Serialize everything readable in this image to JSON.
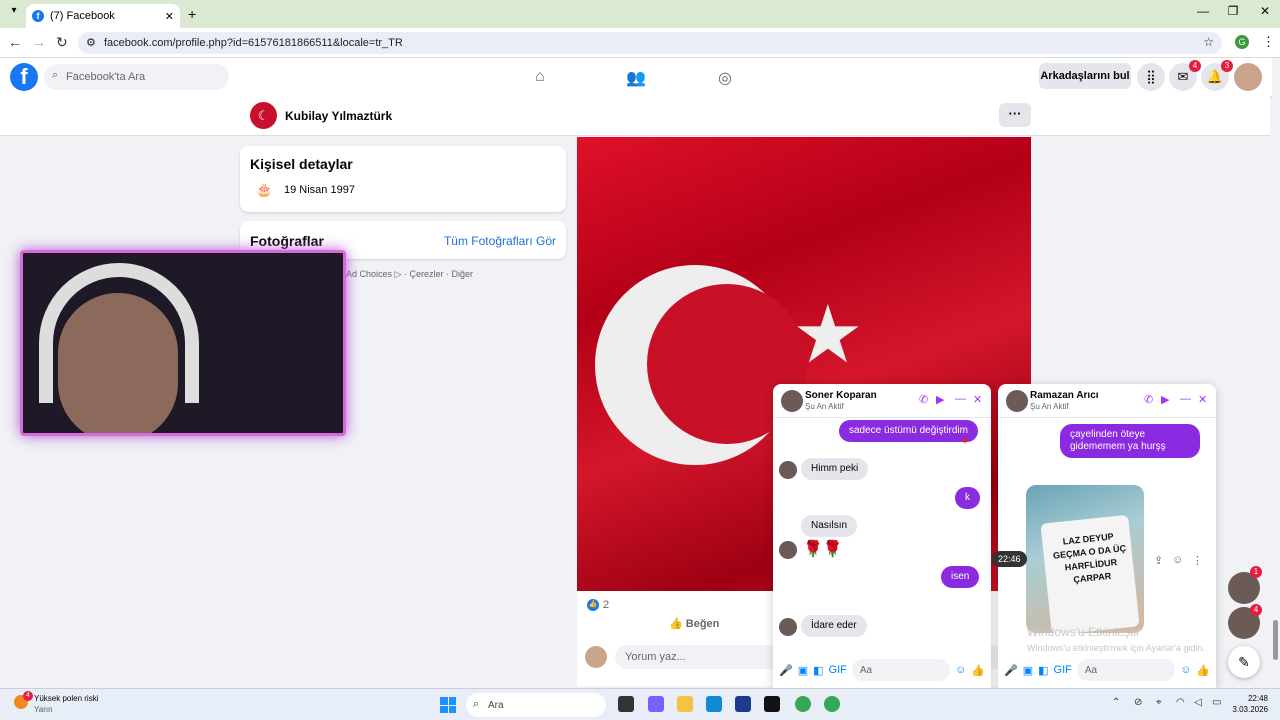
{
  "browser": {
    "tab_title": "(7) Facebook",
    "tab_icon": "facebook-icon",
    "new_tab_symbol": "+",
    "url": "facebook.com/profile.php?id=61576181866511&locale=tr_TR",
    "window_controls": [
      "—",
      "❐",
      "✕"
    ]
  },
  "fb_header": {
    "search_placeholder": "Facebook'ta Ara",
    "find_friends": "Arkadaşlarını bul",
    "messenger_badge": "4",
    "notif_badge": "3"
  },
  "profile": {
    "name": "Kubilay Yılmaztürk",
    "more_label": "···"
  },
  "details": {
    "title": "Kişisel detaylar",
    "birthday": "19 Nisan 1997"
  },
  "photos": {
    "title": "Fotoğraflar",
    "see_all": "Tüm Fotoğrafları Gör"
  },
  "footer": {
    "links": "Ad Choices ▷ · Çerezler · Diğer"
  },
  "post": {
    "like_count": "2",
    "like_label": "Beğen",
    "comment_placeholder": "Yorum yaz..."
  },
  "chat1": {
    "name": "Soner Koparan",
    "status": "Şu An Aktif",
    "messages": [
      {
        "from": "me",
        "text": "sadece üstümü değiştirdim"
      },
      {
        "from": "them",
        "text": "Himm peki"
      },
      {
        "from": "me",
        "text": "k"
      },
      {
        "from": "them",
        "text": "Nasılsın"
      },
      {
        "from": "them",
        "text": "🌹🌹"
      },
      {
        "from": "me",
        "text": "isen"
      },
      {
        "from": "them",
        "text": "İdare eder"
      }
    ],
    "input_placeholder": "Aa"
  },
  "chat2": {
    "name": "Ramazan Arıcı",
    "status": "Şu An Aktif",
    "messages": [
      {
        "from": "me",
        "text": "çayelinden öteye gidememem ya hurşş"
      }
    ],
    "mug_text": "LAZ DEYUP GEÇMA O DA ÜÇ HARFLİDUR ÇARPAR",
    "time": "22:46",
    "input_placeholder": "Aa"
  },
  "watermark": {
    "line1": "Windows'u Etkinleştir",
    "line2": "Windows'u etkinleştirmek için Ayarlar'a gidin."
  },
  "side_chats": [
    {
      "badge": "1"
    },
    {
      "badge": "4"
    }
  ],
  "taskbar": {
    "weather_title": "Yüksek polen riski",
    "weather_sub": "Yarın",
    "weather_badge": "4",
    "search": "Ara",
    "time": "22:48",
    "date": "3.03.2026"
  },
  "colors": {
    "fb_blue": "#1877f2",
    "messenger_purple": "#8a2be2",
    "flag_red": "#c8102e"
  }
}
